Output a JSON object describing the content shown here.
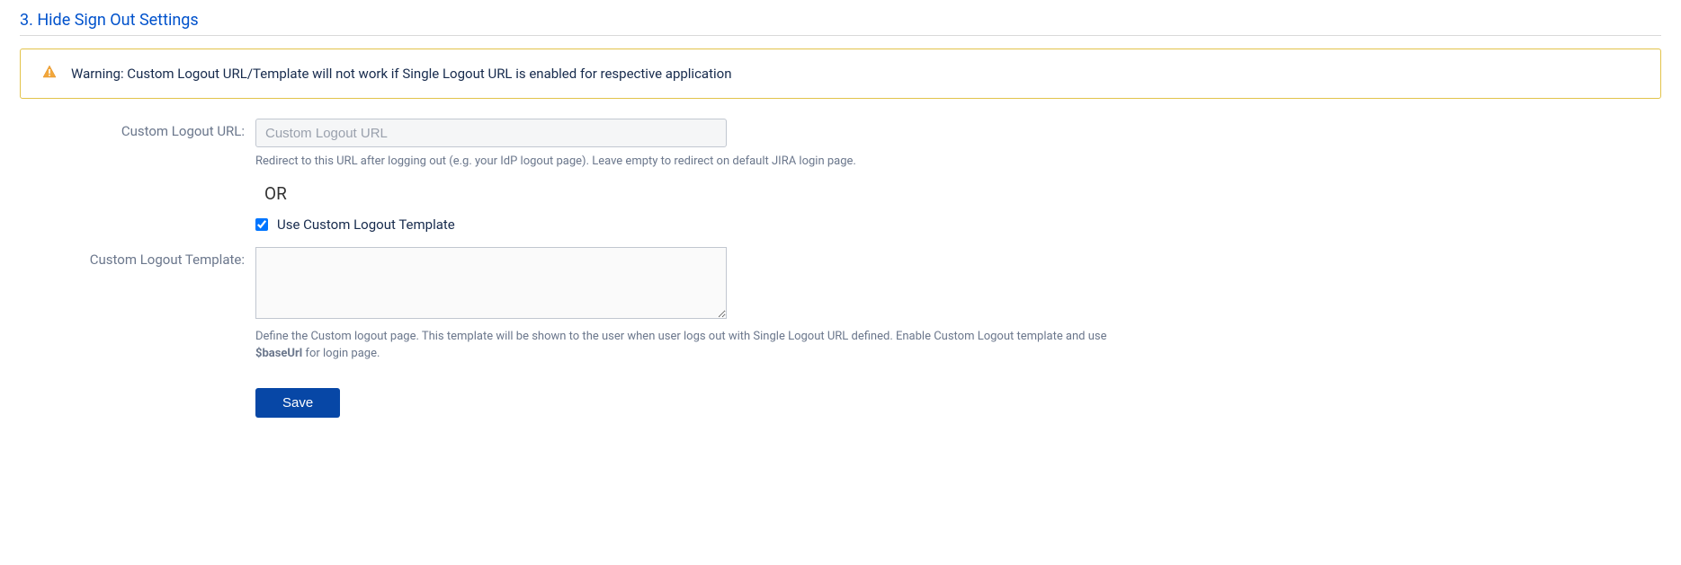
{
  "section": {
    "title": "3. Hide Sign Out Settings"
  },
  "warning": {
    "text": "Warning: Custom Logout URL/Template will not work if Single Logout URL is enabled for respective application"
  },
  "form": {
    "logout_url_label": "Custom Logout URL:",
    "logout_url_placeholder": "Custom Logout URL",
    "logout_url_help": "Redirect to this URL after logging out (e.g. your IdP logout page). Leave empty to redirect on default JIRA login page.",
    "or_text": "OR",
    "use_template_label": "Use Custom Logout Template",
    "template_label": "Custom Logout Template:",
    "template_help_pre": "Define the Custom logout page. This template will be shown to the user when user logs out with Single Logout URL defined. Enable Custom Logout template and use ",
    "template_help_bold": "$baseUrl",
    "template_help_post": " for login page.",
    "save_label": "Save"
  },
  "colors": {
    "primary": "#0052CC",
    "warning_border": "#e2c34a"
  }
}
